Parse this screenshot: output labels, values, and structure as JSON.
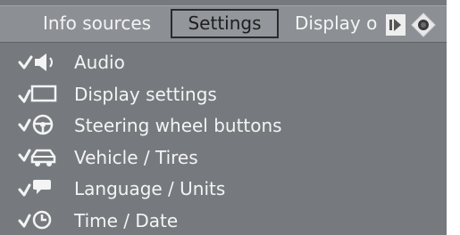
{
  "tabs": {
    "info_sources": "Info sources",
    "settings": "Settings",
    "display_off": "Display o"
  },
  "menu": {
    "items": [
      {
        "label": "Audio",
        "icon": "audio-icon"
      },
      {
        "label": "Display settings",
        "icon": "display-icon"
      },
      {
        "label": "Steering wheel buttons",
        "icon": "steering-wheel-icon"
      },
      {
        "label": "Vehicle / Tires",
        "icon": "vehicle-icon"
      },
      {
        "label": "Language / Units",
        "icon": "language-icon"
      },
      {
        "label": "Time / Date",
        "icon": "clock-icon"
      }
    ]
  },
  "colors": {
    "background": "#767a7e",
    "tab_bar": "#8c9094",
    "selected_tab_border": "#2b2b2b",
    "text": "#f4f4f4"
  }
}
